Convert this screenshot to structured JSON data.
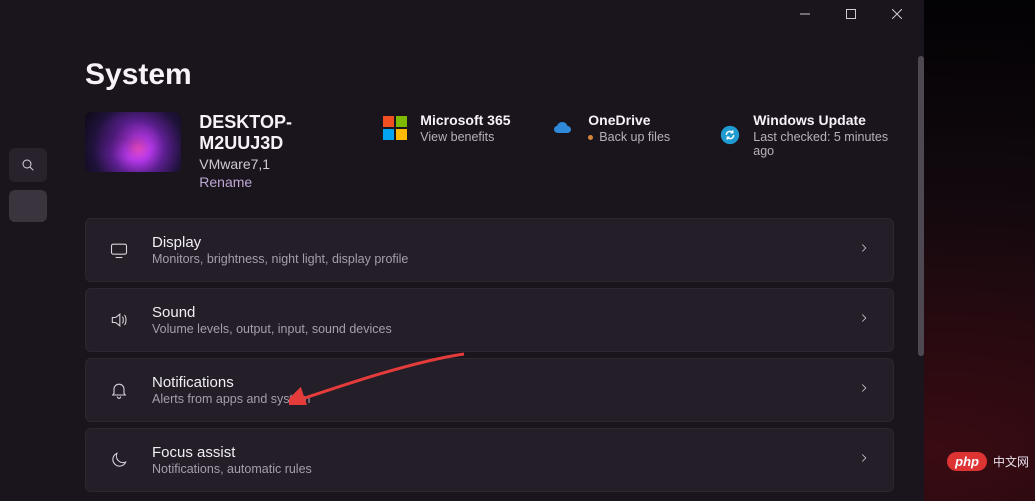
{
  "page": {
    "title": "System"
  },
  "device": {
    "name": "DESKTOP-M2UUJ3D",
    "model": "VMware7,1",
    "rename_label": "Rename"
  },
  "tiles": {
    "ms365": {
      "title": "Microsoft 365",
      "subtitle": "View benefits"
    },
    "onedrive": {
      "title": "OneDrive",
      "subtitle": "Back up files"
    },
    "winupd": {
      "title": "Windows Update",
      "subtitle": "Last checked: 5 minutes ago"
    }
  },
  "rows": {
    "display": {
      "title": "Display",
      "subtitle": "Monitors, brightness, night light, display profile"
    },
    "sound": {
      "title": "Sound",
      "subtitle": "Volume levels, output, input, sound devices"
    },
    "notifications": {
      "title": "Notifications",
      "subtitle": "Alerts from apps and system"
    },
    "focus": {
      "title": "Focus assist",
      "subtitle": "Notifications, automatic rules"
    }
  },
  "watermark": {
    "badge": "php",
    "text": "中文网"
  }
}
